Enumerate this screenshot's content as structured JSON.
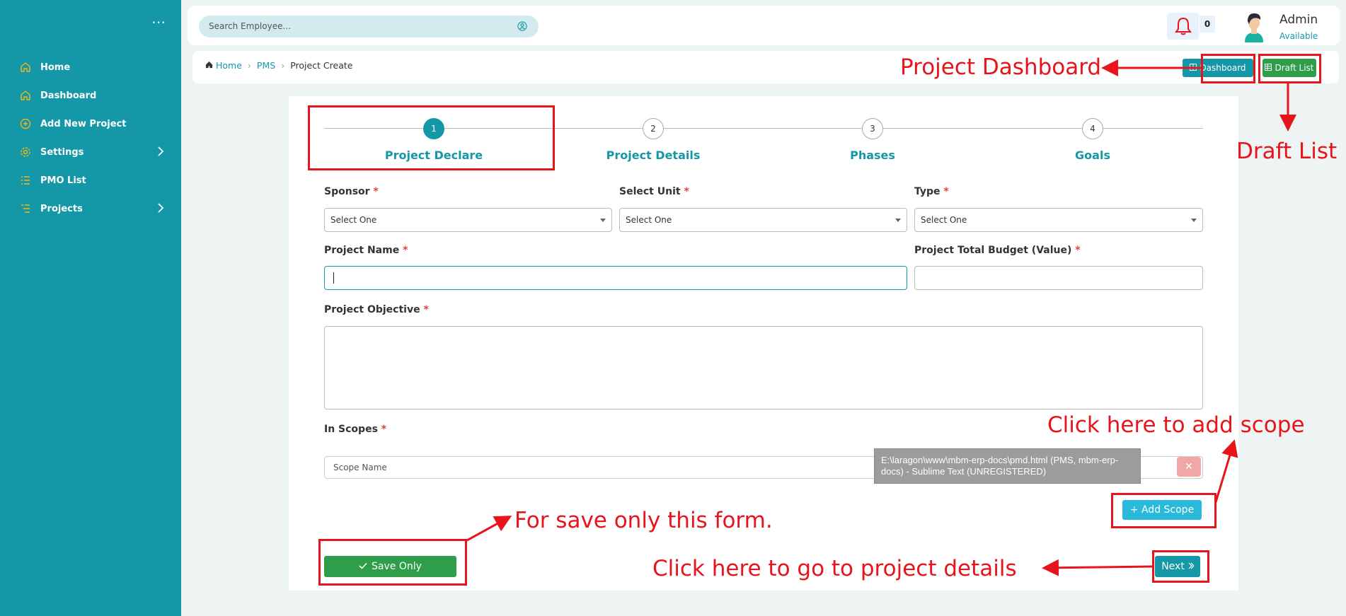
{
  "sidebar": {
    "items": [
      {
        "label": "Home",
        "icon": "home-icon"
      },
      {
        "label": "Dashboard",
        "icon": "home-icon"
      },
      {
        "label": "Add New Project",
        "icon": "plus-circle-icon"
      },
      {
        "label": "Settings",
        "icon": "gear-icon"
      },
      {
        "label": "PMO List",
        "icon": "list-icon"
      },
      {
        "label": "Projects",
        "icon": "list-icon"
      }
    ],
    "icon_color": "#f2b71b"
  },
  "header": {
    "search_placeholder": "Search Employee...",
    "notification_count": "0",
    "user_name": "Admin",
    "user_status": "Available"
  },
  "breadcrumb": {
    "home": "Home",
    "module": "PMS",
    "current": "Project Create"
  },
  "toolbar": {
    "dashboard_label": "Dashboard",
    "draft_label": "Draft List"
  },
  "steps": [
    {
      "number": "1",
      "label": "Project Declare",
      "active": true
    },
    {
      "number": "2",
      "label": "Project Details",
      "active": false
    },
    {
      "number": "3",
      "label": "Phases",
      "active": false
    },
    {
      "number": "4",
      "label": "Goals",
      "active": false
    }
  ],
  "form": {
    "sponsor_label": "Sponsor",
    "unit_label": "Select Unit",
    "type_label": "Type",
    "select_placeholder": "Select One",
    "project_name_label": "Project Name",
    "budget_label": "Project Total Budget (Value)",
    "objective_label": "Project Objective",
    "scopes_label": "In Scopes",
    "scope_placeholder": "Scope Name",
    "required_mark": "*",
    "add_scope_label": "+ Add Scope",
    "save_label": "Save Only",
    "next_label": "Next"
  },
  "tooltip": {
    "text": "E:\\laragon\\www\\mbm-erp-docs\\pmd.html (PMS, mbm-erp-docs) - Sublime Text (UNREGISTERED)"
  },
  "annotations": {
    "dashboard": "Project Dashboard",
    "draft": "Draft List",
    "add_scope": "Click here to add scope",
    "save": "For save only this form.",
    "next": "Click here to go to project details"
  },
  "colors": {
    "primary": "#1497a6",
    "success": "#2e9e4b",
    "info": "#29b9da",
    "annotation_red": "#e8141b"
  }
}
